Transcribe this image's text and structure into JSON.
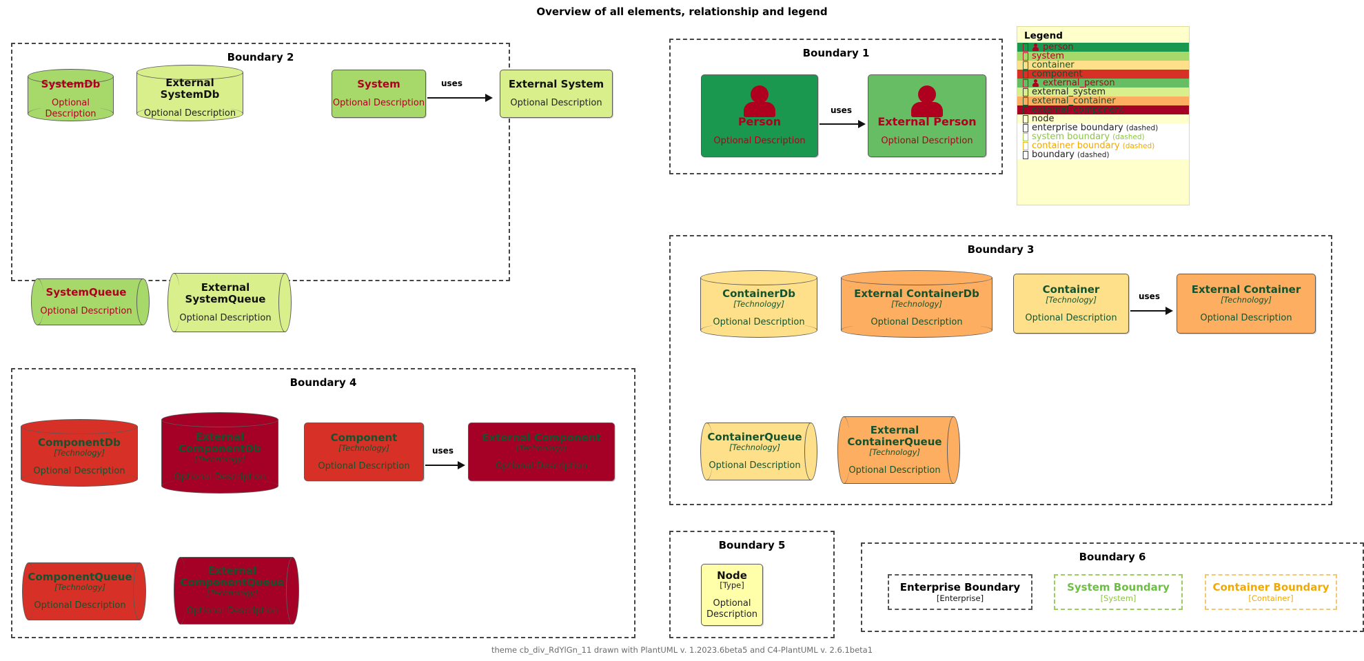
{
  "title": "Overview of all elements, relationship and legend",
  "footer": "theme cb_div_RdYlGn_11 drawn with PlantUML v. 1.2023.6beta5 and C4-PlantUML v. 2.6.1beta1",
  "common": {
    "optional_description": "Optional Description",
    "technology": "[Technology]",
    "uses": "uses"
  },
  "colors": {
    "person": "#1A9850",
    "external_person": "#66BD63",
    "system": "#A6D96A",
    "external_system": "#D9EF8B",
    "container": "#FEE08B",
    "external_container": "#FDAE61",
    "component": "#D73027",
    "external_component": "#A50026",
    "node": "#FFFFAA",
    "legend_bg": "#FFFFCC",
    "title_red": "#B00020",
    "title_green": "#14532d",
    "boundary_gray": "#444444",
    "system_boundary": "#6DBE45",
    "container_boundary": "#F2A900"
  },
  "boundaries": {
    "b1": {
      "label": "Boundary 1"
    },
    "b2": {
      "label": "Boundary 2"
    },
    "b3": {
      "label": "Boundary 3"
    },
    "b4": {
      "label": "Boundary 4"
    },
    "b5": {
      "label": "Boundary 5"
    },
    "b6": {
      "label": "Boundary 6"
    }
  },
  "b1_elements": {
    "person": {
      "title": "Person",
      "desc": "Optional Description"
    },
    "external_person": {
      "title": "External Person",
      "desc": "Optional Description"
    },
    "rel": "uses"
  },
  "b2_elements": {
    "system_db": {
      "title": "SystemDb",
      "desc": "Optional Description"
    },
    "external_system_db": {
      "title": "External SystemDb",
      "desc": "Optional Description"
    },
    "system": {
      "title": "System",
      "desc": "Optional Description"
    },
    "external_system": {
      "title": "External System",
      "desc": "Optional Description"
    },
    "system_queue": {
      "title": "SystemQueue",
      "desc": "Optional Description"
    },
    "external_system_queue": {
      "title": "External SystemQueue",
      "title_l1": "External",
      "title_l2": "SystemQueue",
      "desc": "Optional Description"
    },
    "rel": "uses"
  },
  "b3_elements": {
    "container_db": {
      "title": "ContainerDb",
      "tech": "[Technology]",
      "desc": "Optional Description"
    },
    "external_container_db": {
      "title": "External ContainerDb",
      "tech": "[Technology]",
      "desc": "Optional Description"
    },
    "container": {
      "title": "Container",
      "tech": "[Technology]",
      "desc": "Optional Description"
    },
    "external_container": {
      "title": "External Container",
      "tech": "[Technology]",
      "desc": "Optional Description"
    },
    "container_queue": {
      "title": "ContainerQueue",
      "tech": "[Technology]",
      "desc": "Optional Description"
    },
    "external_container_queue": {
      "title_l1": "External",
      "title_l2": "ContainerQueue",
      "tech": "[Technology]",
      "desc": "Optional Description"
    },
    "rel": "uses"
  },
  "b4_elements": {
    "component_db": {
      "title": "ComponentDb",
      "tech": "[Technology]",
      "desc": "Optional Description"
    },
    "external_component_db": {
      "title_l1": "External",
      "title_l2": "ComponentDb",
      "tech": "[Technology]",
      "desc": "Optional Description"
    },
    "component": {
      "title": "Component",
      "tech": "[Technology]",
      "desc": "Optional Description"
    },
    "external_component": {
      "title": "External Component",
      "tech": "[Technology]",
      "desc": "Optional Description"
    },
    "component_queue": {
      "title": "ComponentQueue",
      "tech": "[Technology]",
      "desc": "Optional Description"
    },
    "external_component_queue": {
      "title_l1": "External",
      "title_l2": "ComponentQueue",
      "tech": "[Technology]",
      "desc": "Optional Description"
    },
    "rel": "uses"
  },
  "b5_elements": {
    "node": {
      "title": "Node",
      "type": "[Type]",
      "desc": "Optional Description"
    }
  },
  "b6_elements": {
    "enterprise_boundary": {
      "title": "Enterprise Boundary",
      "type": "[Enterprise]"
    },
    "system_boundary": {
      "title": "System Boundary",
      "type": "[System]"
    },
    "container_boundary": {
      "title": "Container Boundary",
      "type": "[Container]"
    }
  },
  "legend": {
    "title": "Legend",
    "rows": [
      {
        "label": "person",
        "sub": "",
        "bg": "#1A9850",
        "fg": "#B00020",
        "person_icon": true
      },
      {
        "label": "system",
        "sub": "",
        "bg": "#A6D96A",
        "fg": "#B00020",
        "person_icon": false
      },
      {
        "label": "container",
        "sub": "",
        "bg": "#FEE08B",
        "fg": "#14532d",
        "person_icon": false
      },
      {
        "label": "component",
        "sub": "",
        "bg": "#D73027",
        "fg": "#14532d",
        "person_icon": false
      },
      {
        "label": "external_person",
        "sub": "",
        "bg": "#66BD63",
        "fg": "#B00020",
        "person_icon": true
      },
      {
        "label": "external_system",
        "sub": "",
        "bg": "#D9EF8B",
        "fg": "#222222",
        "person_icon": false
      },
      {
        "label": "external_container",
        "sub": "",
        "bg": "#FDAE61",
        "fg": "#14532d",
        "person_icon": false
      },
      {
        "label": "external_component",
        "sub": "",
        "bg": "#A50026",
        "fg": "#14532d",
        "person_icon": false
      },
      {
        "label": "node",
        "sub": "",
        "bg": "#FFFFCC",
        "fg": "#222222",
        "person_icon": false
      },
      {
        "label": "enterprise boundary",
        "sub": "(dashed)",
        "bg": "#FFFFFF",
        "fg": "#222222",
        "person_icon": false
      },
      {
        "label": "system boundary",
        "sub": "(dashed)",
        "bg": "#FFFFFF",
        "fg": "#8CC63F",
        "person_icon": false
      },
      {
        "label": "container boundary",
        "sub": "(dashed)",
        "bg": "#FFFFFF",
        "fg": "#F2A900",
        "person_icon": false
      },
      {
        "label": "boundary",
        "sub": "(dashed)",
        "bg": "#FFFFFF",
        "fg": "#222222",
        "person_icon": false
      }
    ]
  }
}
